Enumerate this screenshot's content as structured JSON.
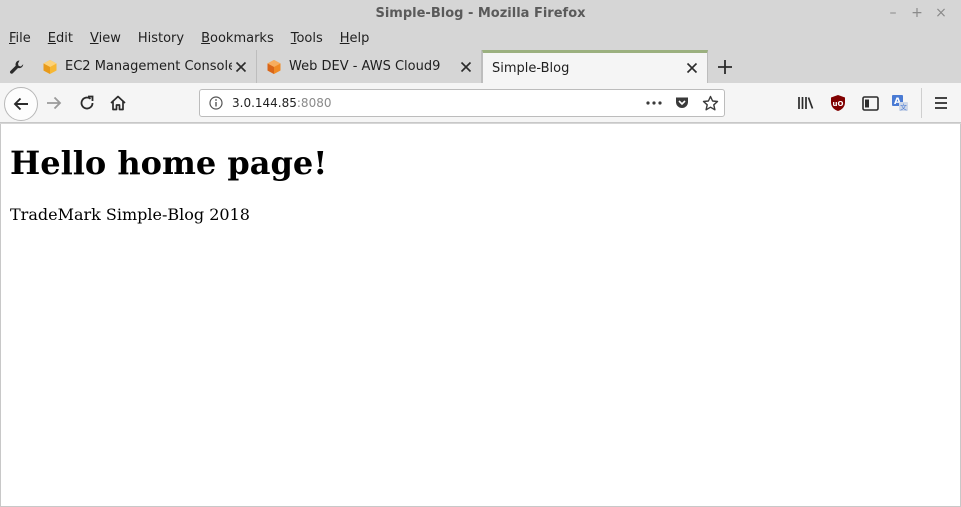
{
  "window": {
    "title": "Simple-Blog - Mozilla Firefox",
    "controls": {
      "minimize": "–",
      "maximize": "+",
      "close": "×"
    }
  },
  "menubar": {
    "items": [
      {
        "label": "File",
        "accel": "F",
        "rest": "ile"
      },
      {
        "label": "Edit",
        "accel": "E",
        "rest": "dit"
      },
      {
        "label": "View",
        "accel": "V",
        "rest": "iew"
      },
      {
        "label": "History",
        "accel": "H",
        "rest": "istory",
        "pre": ""
      },
      {
        "label": "Bookmarks",
        "accel": "B",
        "rest": "ookmarks"
      },
      {
        "label": "Tools",
        "accel": "T",
        "rest": "ools"
      },
      {
        "label": "Help",
        "accel": "H",
        "rest": "elp"
      }
    ]
  },
  "tabs": [
    {
      "label": "EC2 Management Console",
      "icon": "aws-box-icon",
      "active": false
    },
    {
      "label": "Web DEV - AWS Cloud9",
      "icon": "cloud9-cube-icon",
      "active": false
    },
    {
      "label": "Simple-Blog",
      "icon": "",
      "active": true
    }
  ],
  "newtab": "+",
  "urlbar": {
    "host": "3.0.144.85",
    "port": ":8080"
  },
  "page": {
    "heading": "Hello home page!",
    "footer": "TradeMark Simple-Blog 2018"
  },
  "colors": {
    "active_tab_accent": "#9bb07f",
    "chrome_bg": "#d6d6d6",
    "toolbar_bg": "#f5f5f5",
    "ublock_red": "#800000"
  }
}
